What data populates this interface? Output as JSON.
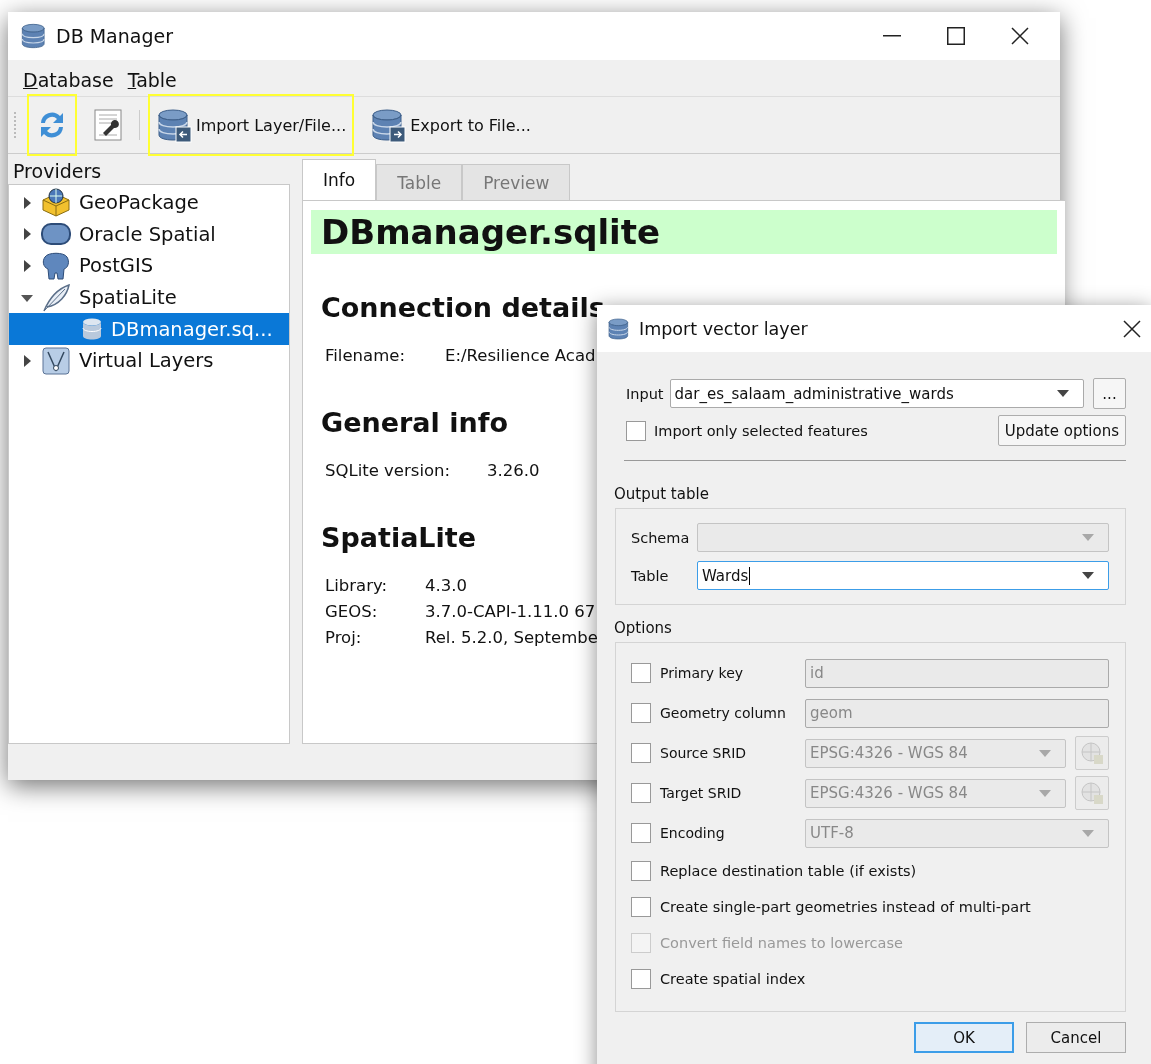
{
  "main_window": {
    "title": "DB Manager",
    "menu": [
      "Database",
      "Table"
    ],
    "toolbar": [
      {
        "kind": "refresh",
        "highlighted": true
      },
      {
        "kind": "info",
        "highlighted": false
      },
      {
        "kind": "import",
        "label": "Import Layer/File...",
        "highlighted": true
      },
      {
        "kind": "export",
        "label": "Export to File...",
        "highlighted": false
      }
    ],
    "providers_label": "Providers",
    "tree": [
      {
        "kind": "geopackage",
        "label": "GeoPackage",
        "expanded": false,
        "selected": false
      },
      {
        "kind": "oracle",
        "label": "Oracle Spatial",
        "expanded": false,
        "selected": false
      },
      {
        "kind": "postgis",
        "label": "PostGIS",
        "expanded": false,
        "selected": false
      },
      {
        "kind": "spatialite",
        "label": "SpatiaLite",
        "expanded": true,
        "selected": false,
        "children": [
          {
            "kind": "db",
            "label": "DBmanager.sq...",
            "selected": true
          }
        ]
      },
      {
        "kind": "virtual",
        "label": "Virtual Layers",
        "expanded": false,
        "selected": false
      }
    ],
    "tabs": [
      {
        "label": "Info",
        "selected": true
      },
      {
        "label": "Table",
        "selected": false
      },
      {
        "label": "Preview",
        "selected": false
      }
    ],
    "info": {
      "title": "DBmanager.sqlite",
      "sections": [
        {
          "heading": "Connection details",
          "rows": [
            {
              "label": "Filename:",
              "value": "E:/Resilience Acad"
            }
          ]
        },
        {
          "heading": "General info",
          "rows": [
            {
              "label": "SQLite version:",
              "value": "3.26.0"
            }
          ]
        },
        {
          "heading": "SpatiaLite",
          "rows": [
            {
              "label": "Library:",
              "value": "4.3.0"
            },
            {
              "label": "GEOS:",
              "value": "3.7.0-CAPI-1.11.0 67"
            },
            {
              "label": "Proj:",
              "value": "Rel. 5.2.0, Septembe"
            }
          ]
        }
      ]
    }
  },
  "dialog": {
    "title": "Import vector layer",
    "input": {
      "label": "Input",
      "value": "dar_es_salaam_administrative_wards"
    },
    "browse_button": "...",
    "import_selected": {
      "label": "Import only selected features",
      "checked": false
    },
    "update_button": "Update options",
    "output_table": {
      "title": "Output table",
      "schema": {
        "label": "Schema",
        "disabled": true
      },
      "table": {
        "label": "Table",
        "value": "Wards",
        "disabled": false
      }
    },
    "options": {
      "title": "Options",
      "items": [
        {
          "kind": "text",
          "label": "Primary key",
          "checked": false,
          "disabled": false,
          "value": "id"
        },
        {
          "kind": "text",
          "label": "Geometry column",
          "checked": false,
          "disabled": false,
          "value": "geom"
        },
        {
          "kind": "crs",
          "label": "Source SRID",
          "checked": false,
          "disabled": false,
          "value": "EPSG:4326 - WGS 84"
        },
        {
          "kind": "crs",
          "label": "Target SRID",
          "checked": false,
          "disabled": false,
          "value": "EPSG:4326 - WGS 84"
        },
        {
          "kind": "combo",
          "label": "Encoding",
          "checked": false,
          "disabled": false,
          "value": "UTF-8"
        },
        {
          "kind": "plain",
          "label": "Replace destination table (if exists)",
          "checked": false,
          "disabled": false
        },
        {
          "kind": "plain",
          "label": "Create single-part geometries instead of multi-part",
          "checked": false,
          "disabled": false
        },
        {
          "kind": "plain",
          "label": "Convert field names to lowercase",
          "checked": false,
          "disabled": true
        },
        {
          "kind": "plain",
          "label": "Create spatial index",
          "checked": false,
          "disabled": false
        }
      ]
    },
    "buttons": [
      {
        "label": "OK",
        "default": true
      },
      {
        "label": "Cancel",
        "default": false
      }
    ]
  }
}
